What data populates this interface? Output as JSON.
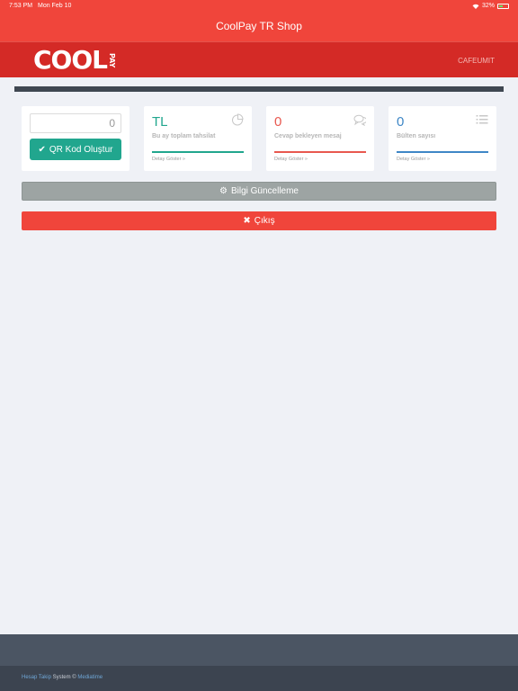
{
  "status_bar": {
    "time": "7:53 PM",
    "date": "Mon Feb 10",
    "battery": "32%",
    "battery_level": 0.32
  },
  "nav": {
    "title": "CoolPay TR Shop"
  },
  "brand": {
    "logo_text": "COOL",
    "logo_sub": "PAY",
    "user": "CAFEUMIT"
  },
  "qr": {
    "value": "0",
    "button_label": "QR Kod Oluştur"
  },
  "stats": [
    {
      "value": "TL",
      "label": "Bu ay toplam tahsilat",
      "detail": "Detay Göster »",
      "color": "#21a68e",
      "icon": "pie-chart-icon"
    },
    {
      "value": "0",
      "label": "Cevap bekleyen mesaj",
      "detail": "Detay Göster »",
      "color": "#e8584f",
      "icon": "comments-icon"
    },
    {
      "value": "0",
      "label": "Bülten sayısı",
      "detail": "Detay Göster »",
      "color": "#3f87c6",
      "icon": "list-icon"
    }
  ],
  "actions": {
    "update_label": "Bilgi Güncelleme",
    "logout_label": "Çıkış"
  },
  "footer": {
    "link1": "Hesap Takip",
    "mid": " System © ",
    "link2": "Mediatime"
  },
  "colors": {
    "brand": "#f0453b",
    "brand_dark": "#d42a26",
    "teal": "#21a68e",
    "gray": "#9da4a3"
  }
}
